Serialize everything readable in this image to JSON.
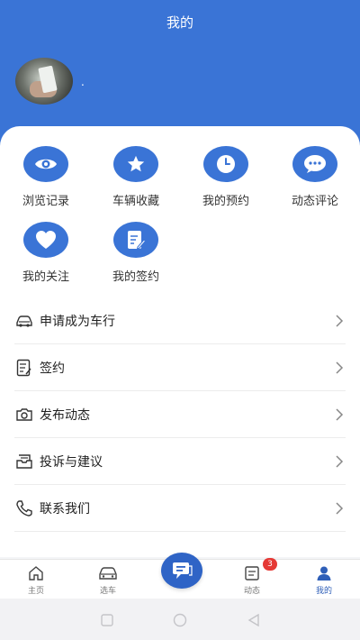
{
  "header": {
    "title": "我的",
    "username": "."
  },
  "grid": [
    {
      "label": "浏览记录",
      "icon": "eye-icon"
    },
    {
      "label": "车辆收藏",
      "icon": "star-icon"
    },
    {
      "label": "我的预约",
      "icon": "clock-icon"
    },
    {
      "label": "动态评论",
      "icon": "comment-icon"
    },
    {
      "label": "我的关注",
      "icon": "heart-icon"
    },
    {
      "label": "我的签约",
      "icon": "document-edit-icon"
    }
  ],
  "menu": [
    {
      "label": "申请成为车行",
      "icon": "car-icon"
    },
    {
      "label": "签约",
      "icon": "contract-icon"
    },
    {
      "label": "发布动态",
      "icon": "camera-icon"
    },
    {
      "label": "投诉与建议",
      "icon": "inbox-icon"
    },
    {
      "label": "联系我们",
      "icon": "phone-icon"
    }
  ],
  "tabbar": {
    "items": [
      {
        "label": "主页",
        "icon": "home-icon"
      },
      {
        "label": "选车",
        "icon": "car-icon"
      },
      {
        "label": "动态",
        "icon": "news-icon",
        "badge": "3"
      },
      {
        "label": "我的",
        "icon": "user-icon"
      }
    ],
    "active": "我的"
  },
  "colors": {
    "primary": "#3a74d6",
    "badge": "#e53935"
  }
}
